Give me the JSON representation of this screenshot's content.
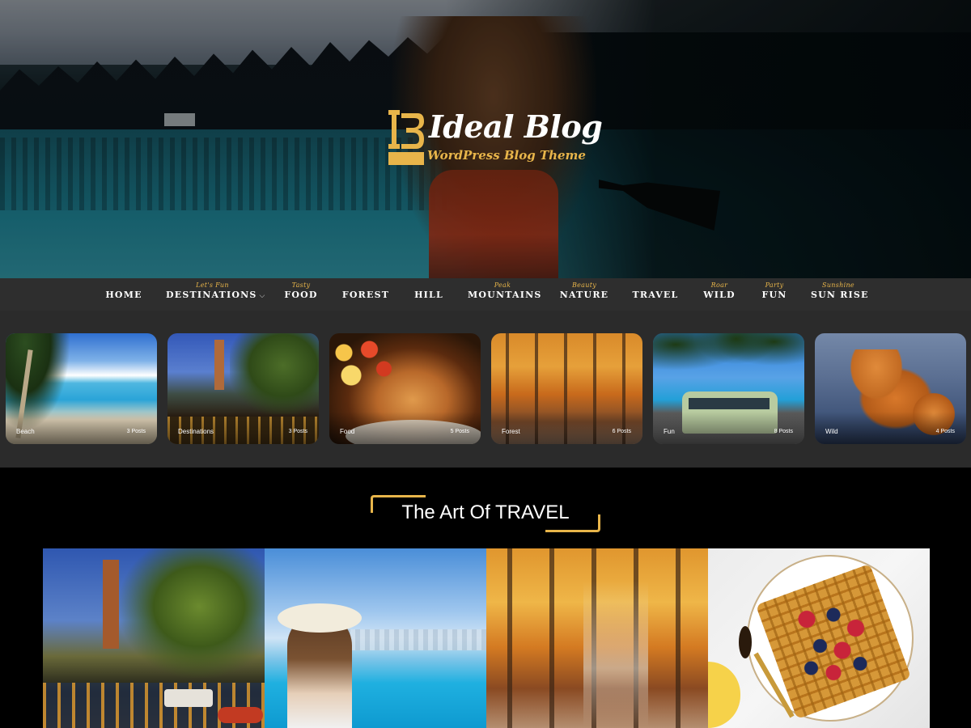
{
  "site": {
    "title": "Ideal Blog",
    "tagline": "WordPress Blog Theme",
    "logo_mark": "IB",
    "accent_color": "#e8b54a"
  },
  "nav": {
    "items": [
      {
        "label": "HOME",
        "tag": ""
      },
      {
        "label": "DESTINATIONS",
        "tag": "Let's Fun",
        "dropdown": true,
        "chevron": "⌵"
      },
      {
        "label": "FOOD",
        "tag": "Tasty"
      },
      {
        "label": "FOREST",
        "tag": ""
      },
      {
        "label": "HILL",
        "tag": ""
      },
      {
        "label": "MOUNTAINS",
        "tag": "Peak"
      },
      {
        "label": "NATURE",
        "tag": "Beauty"
      },
      {
        "label": "TRAVEL",
        "tag": ""
      },
      {
        "label": "WILD",
        "tag": "Roar"
      },
      {
        "label": "FUN",
        "tag": "Party"
      },
      {
        "label": "SUN RISE",
        "tag": "Sunshine"
      }
    ]
  },
  "categories": [
    {
      "name": "Beach",
      "count": "3 Posts",
      "image": "beach-resort-image"
    },
    {
      "name": "Destinations",
      "count": "3 Posts",
      "image": "canal-city-image"
    },
    {
      "name": "Food",
      "count": "5 Posts",
      "image": "roast-chicken-image"
    },
    {
      "name": "Forest",
      "count": "6 Posts",
      "image": "autumn-forest-image"
    },
    {
      "name": "Fun",
      "count": "8 Posts",
      "image": "beach-van-image"
    },
    {
      "name": "Wild",
      "count": "4 Posts",
      "image": "fox-image"
    }
  ],
  "section": {
    "title": "The Art Of TRAVEL"
  },
  "gallery": [
    {
      "image": "canal-city-image"
    },
    {
      "image": "pool-woman-hat-image"
    },
    {
      "image": "autumn-forest-image"
    },
    {
      "image": "waffle-berries-image"
    }
  ]
}
